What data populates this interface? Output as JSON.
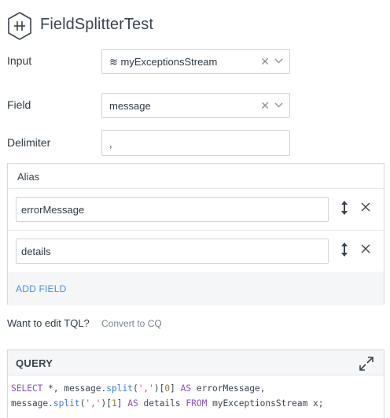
{
  "header": {
    "title": "FieldSplitterTest",
    "icon": "field-splitter-hex-icon"
  },
  "form": {
    "input_label": "Input",
    "input_icon": "≋",
    "input_value": "myExceptionsStream",
    "field_label": "Field",
    "field_value": "message",
    "delimiter_label": "Delimiter",
    "delimiter_value": ","
  },
  "alias": {
    "header": "Alias",
    "items": [
      {
        "value": "errorMessage"
      },
      {
        "value": "details"
      }
    ],
    "add_label": "ADD FIELD"
  },
  "tql": {
    "question": "Want to edit TQL?",
    "link": "Convert to CQ"
  },
  "query": {
    "header": "QUERY",
    "code_parts": {
      "select": "SELECT",
      "star": " *, message.",
      "split": "split",
      "open": "(",
      "delim": "','",
      "close0": ")[",
      "idx0": "0",
      "end0": "] ",
      "as": "AS",
      "alias0": " errorMessage,",
      "msg": "message.",
      "idx1": "1",
      "alias1": " details ",
      "from": "FROM",
      "tail": " myExceptionsStream x;"
    }
  },
  "colors": {
    "accent": "#4a90d9",
    "keyword": "#8b4fc2",
    "function": "#3a7bd5",
    "string": "#d24b86"
  }
}
